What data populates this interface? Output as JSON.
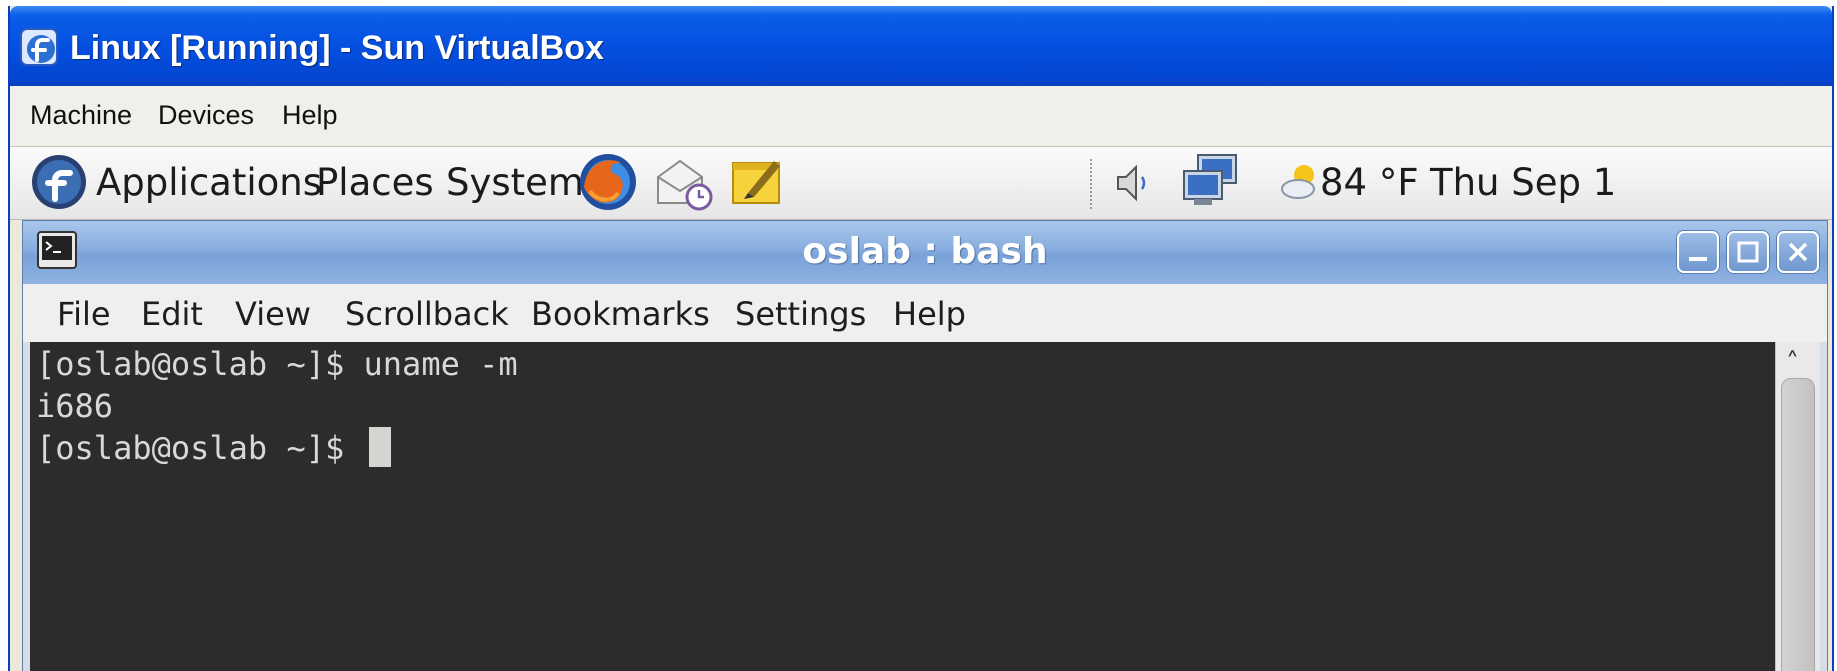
{
  "window": {
    "title": "Linux [Running] - Sun VirtualBox",
    "menu": [
      "Machine",
      "Devices",
      "Help"
    ]
  },
  "panel": {
    "menus": [
      "Applications",
      "Places",
      "System"
    ],
    "launchers": [
      "firefox-icon",
      "mail-clock-icon",
      "notes-icon"
    ],
    "tray": [
      "volume-icon",
      "network-icon"
    ],
    "weather": "84 °F",
    "clock": "Thu Sep 1"
  },
  "konsole": {
    "title": "oslab : bash",
    "menu": [
      "File",
      "Edit",
      "View",
      "Scrollback",
      "Bookmarks",
      "Settings",
      "Help"
    ],
    "lines": [
      "[oslab@oslab ~]$ uname -m",
      "i686",
      "[oslab@oslab ~]$ "
    ]
  },
  "colors": {
    "xp_title": "#0550e0",
    "terminal_bg": "#2c2c2c",
    "terminal_fg": "#d8d8d8",
    "konsole_title": "#87aee0"
  }
}
